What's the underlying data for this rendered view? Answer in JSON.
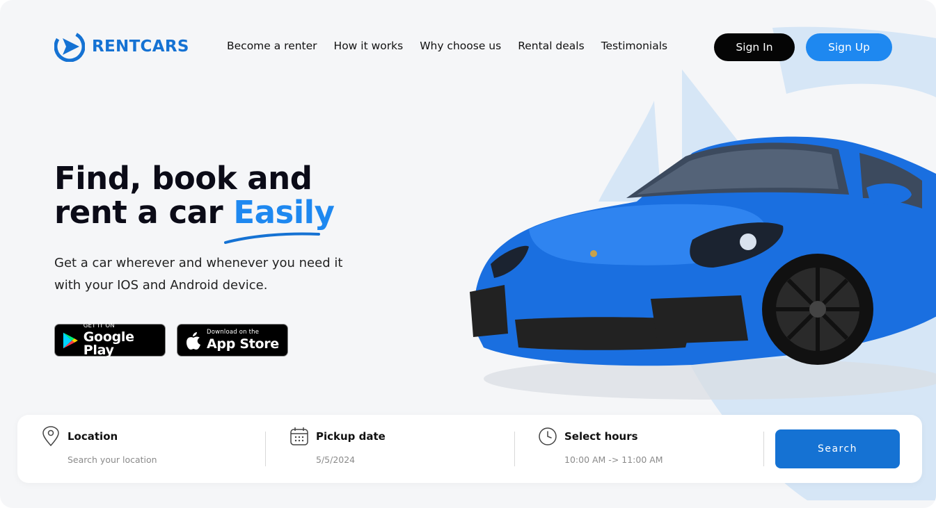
{
  "brand": {
    "name": "RENTCARS",
    "color": "#1572d3"
  },
  "nav": {
    "items": [
      {
        "label": "Become a renter"
      },
      {
        "label": "How it works"
      },
      {
        "label": "Why choose us"
      },
      {
        "label": "Rental deals"
      },
      {
        "label": "Testimonials"
      }
    ]
  },
  "auth": {
    "sign_in": "Sign In",
    "sign_up": "Sign Up"
  },
  "hero": {
    "title_line1": "Find, book and",
    "title_line2": "rent a car ",
    "title_accent": "Easily",
    "subtitle": "Get a car wherever and whenever you need it with your IOS and Android device."
  },
  "stores": {
    "google": {
      "small": "GET IT ON",
      "big": "Google Play",
      "icon": "google-play-icon"
    },
    "apple": {
      "small": "Download on the",
      "big": "App Store",
      "icon": "apple-icon"
    }
  },
  "search": {
    "location": {
      "label": "Location",
      "placeholder": "Search your location",
      "icon": "location-pin-icon"
    },
    "pickup": {
      "label": "Pickup date",
      "value": "5/5/2024",
      "icon": "calendar-icon"
    },
    "hours": {
      "label": "Select hours",
      "value": "10:00 AM -> 11:00 AM",
      "icon": "clock-icon"
    },
    "button": "Search"
  },
  "colors": {
    "accent": "#1e88f0",
    "primary": "#1572d3",
    "dark": "#050505",
    "car": "#1a6fe0"
  }
}
